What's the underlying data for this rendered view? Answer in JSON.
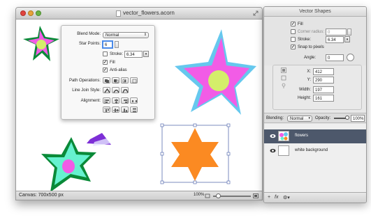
{
  "document": {
    "title": "vector_flowers.acorn",
    "status": {
      "canvas_size": "Canvas: 700x500 px",
      "zoom": "100%"
    }
  },
  "shape_hud": {
    "blend_mode_label": "Blend Mode:",
    "blend_mode_value": "Normal",
    "star_points_label": "Star Points:",
    "star_points_value": "6",
    "stroke_label": "Stroke:",
    "stroke_value": "6.34",
    "stroke_checked": false,
    "fill_label": "Fill",
    "fill_checked": true,
    "antialias_label": "Anti-alias",
    "antialias_checked": true,
    "path_operations_label": "Path Operations:",
    "line_join_label": "Line Join Style:",
    "alignment_label": "Alignment:"
  },
  "inspector": {
    "title": "Vector Shapes",
    "fill_label": "Fill",
    "fill_checked": true,
    "corner_radius_label": "Corner radius:",
    "corner_radius_value": "0",
    "corner_radius_checked": false,
    "stroke_label": "Stroke:",
    "stroke_value": "6.34",
    "stroke_checked": false,
    "snap_label": "Snap to pixels",
    "snap_checked": true,
    "angle_label": "Angle:",
    "angle_value": "0",
    "x_label": "X:",
    "x_value": "412",
    "y_label": "Y:",
    "y_value": "290",
    "width_label": "Width:",
    "width_value": "197",
    "height_label": "Height:",
    "height_value": "161",
    "blending_label": "Blending:",
    "blending_value": "Normal",
    "opacity_label": "Opacity:",
    "opacity_value": "100%",
    "layers": [
      {
        "name": "flowers",
        "selected": true
      },
      {
        "name": "white background",
        "selected": false
      }
    ]
  },
  "colors": {
    "pink": "#f25ce6",
    "cyan": "#66c8ee",
    "lime": "#d4ee6a",
    "mint": "#66f2cf",
    "green": "#0a8a38",
    "orange": "#fb8a22",
    "selection_blue": "#4d586b"
  }
}
